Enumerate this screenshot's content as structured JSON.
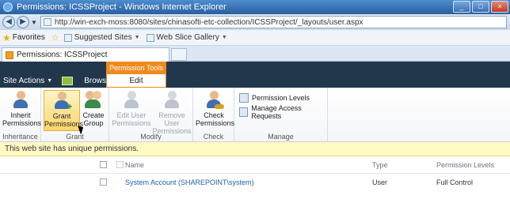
{
  "window": {
    "title": "Permissions: ICSSProject - Windows Internet Explorer",
    "controls": [
      "_",
      "□",
      "×"
    ]
  },
  "address": {
    "back": "◀",
    "forward": "▶",
    "url": "http://win-exch-moss:8080/sites/chinasofti-etc-collection/ICSSProject/_layouts/user.aspx"
  },
  "favorites": {
    "label": "Favorites",
    "links": [
      "Suggested Sites",
      "Web Slice Gallery"
    ]
  },
  "tab": {
    "label": "Permissions: ICSSProject"
  },
  "sharepoint": {
    "site_actions": "Site Actions",
    "browse": "Browse",
    "permission_tools": "Permission Tools",
    "edit": "Edit"
  },
  "ribbon": {
    "groups": {
      "inheritance": "Inheritance",
      "grant": "Grant",
      "modify": "Modify",
      "check": "Check",
      "manage": "Manage"
    },
    "buttons": {
      "inherit_l1": "Inherit",
      "inherit_l2": "Permissions",
      "grant_l1": "Grant",
      "grant_l2": "Permissions",
      "create_l1": "Create",
      "create_l2": "Group",
      "edit_user_l1": "Edit User",
      "edit_user_l2": "Permissions",
      "remove_user_l1": "Remove User",
      "remove_user_l2": "Permissions",
      "check_l1": "Check",
      "check_l2": "Permissions",
      "permission_levels": "Permission Levels",
      "manage_access": "Manage Access Requests"
    }
  },
  "notice": "This web site has unique permissions.",
  "table": {
    "headers": {
      "name": "Name",
      "type": "Type",
      "permission_levels": "Permission Levels"
    },
    "rows": [
      {
        "name": "System Account (SHAREPOINT\\system)",
        "type": "User",
        "level": "Full Control"
      }
    ]
  }
}
